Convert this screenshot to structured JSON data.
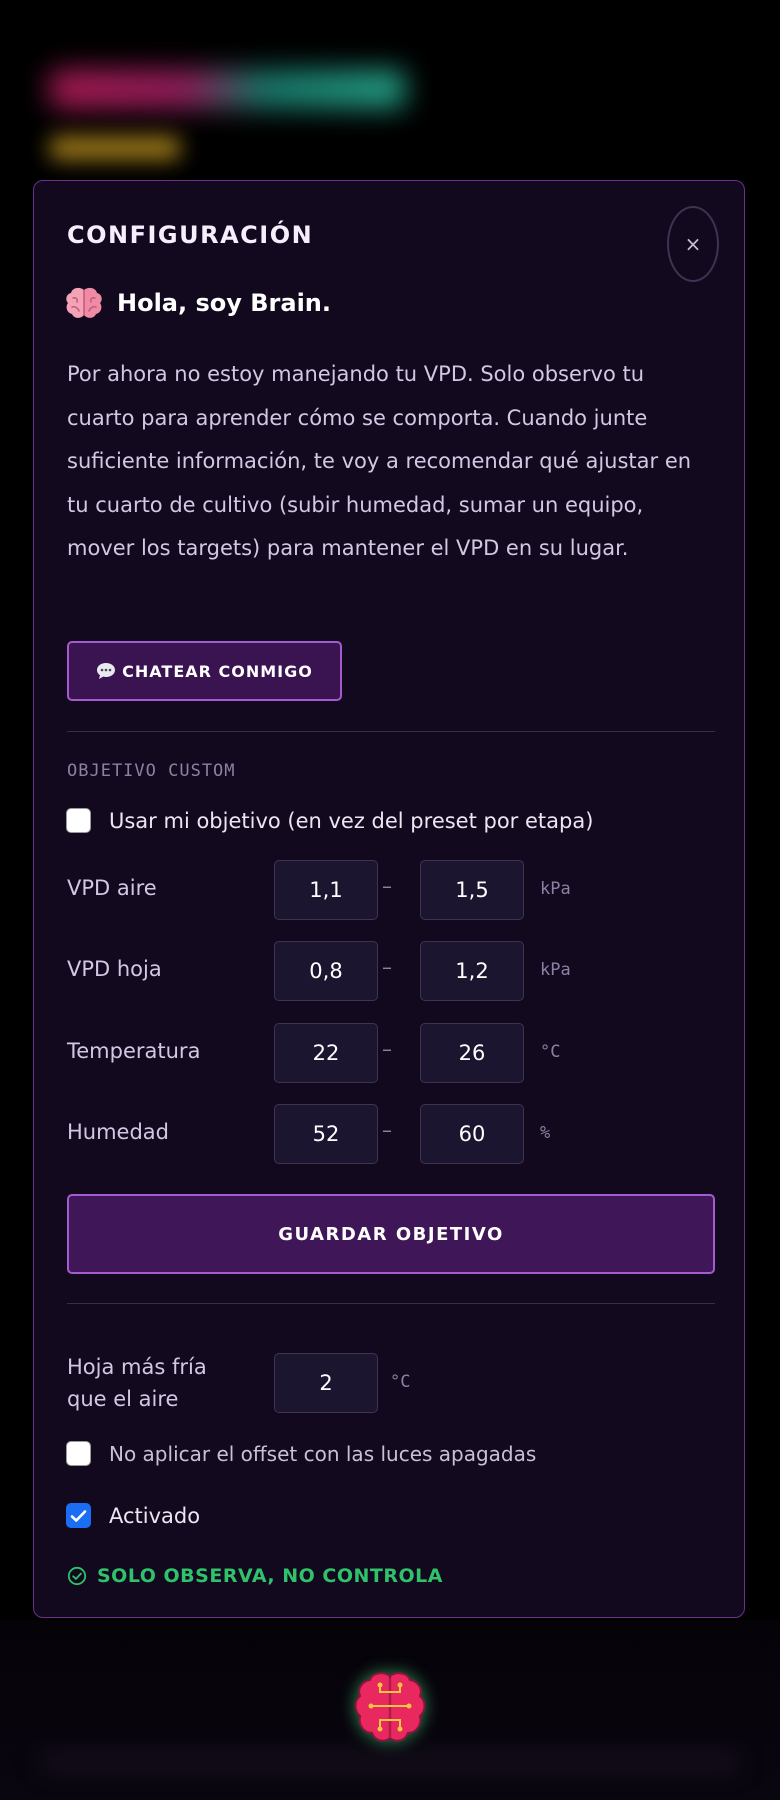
{
  "header": {
    "title": "Configuración",
    "close_label": "×"
  },
  "brain": {
    "greeting": "Hola, soy Brain.",
    "intro": "Por ahora no estoy manejando tu VPD. Solo observo tu cuarto para aprender cómo se comporta. Cuando junte suficiente información, te voy a recomendar qué ajustar en tu cuarto de cultivo (subir humedad, sumar un equipo, mover los targets) para mantener el VPD en su lugar.",
    "chat_label": "CHATEAR CONMIGO"
  },
  "custom_target": {
    "section_label": "OBJETIVO CUSTOM",
    "use_custom_label": "Usar mi objetivo (en vez del preset por etapa)",
    "use_custom_checked": false,
    "separator": "–",
    "rows": [
      {
        "label": "VPD aire",
        "min": "1,1",
        "max": "1,5",
        "unit": "kPa"
      },
      {
        "label": "VPD hoja",
        "min": "0,8",
        "max": "1,2",
        "unit": "kPa"
      },
      {
        "label": "Temperatura",
        "min": "22",
        "max": "26",
        "unit": "°C"
      },
      {
        "label": "Humedad",
        "min": "52",
        "max": "60",
        "unit": "%"
      }
    ],
    "save_label": "GUARDAR OBJETIVO"
  },
  "leaf_offset": {
    "label": "Hoja más fría que el aire",
    "value": "2",
    "unit": "°C",
    "lights_off_label": "No aplicar el offset con las luces apagadas",
    "lights_off_checked": false,
    "enabled_label": "Activado",
    "enabled_checked": true
  },
  "status": {
    "text": "SOLO OBSERVA, NO CONTROLA",
    "icon": "check-circle-icon",
    "color": "#2fc26a"
  },
  "theme": {
    "accent": "#a45bd0",
    "panel_bg": "#12091f",
    "brain_pink": "#e8285f",
    "brain_glow": "#46dc78"
  }
}
